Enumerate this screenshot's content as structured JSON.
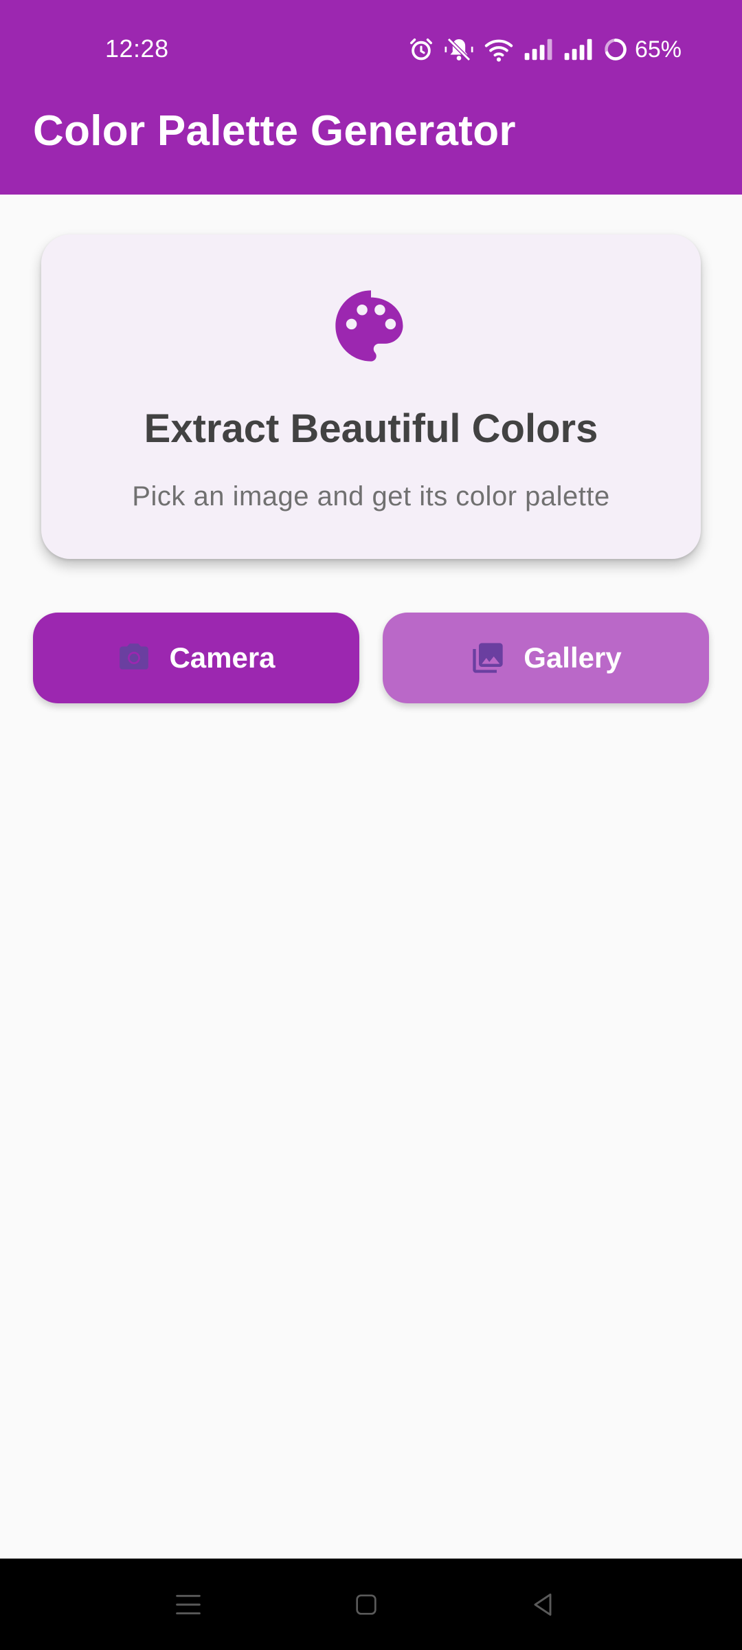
{
  "status_bar": {
    "time": "12:28",
    "battery_percent": "65%",
    "icons": [
      "alarm-icon",
      "bell-muted-icon",
      "wifi-icon",
      "signal-icon",
      "signal-icon",
      "battery-icon"
    ]
  },
  "app_bar": {
    "title": "Color Palette Generator"
  },
  "card": {
    "icon": "palette-icon",
    "title": "Extract Beautiful Colors",
    "subtitle": "Pick an image and get its color palette"
  },
  "buttons": {
    "camera": {
      "label": "Camera",
      "icon": "camera-icon"
    },
    "gallery": {
      "label": "Gallery",
      "icon": "gallery-icon"
    }
  },
  "nav_bar": {
    "icons": [
      "menu-icon",
      "home-icon",
      "back-icon"
    ]
  },
  "colors": {
    "primary": "#9c27b0",
    "primary_light": "#ba68c8",
    "card_bg": "#f5eff8",
    "background": "#fafafa",
    "icon_tint": "#6a3fa0"
  }
}
